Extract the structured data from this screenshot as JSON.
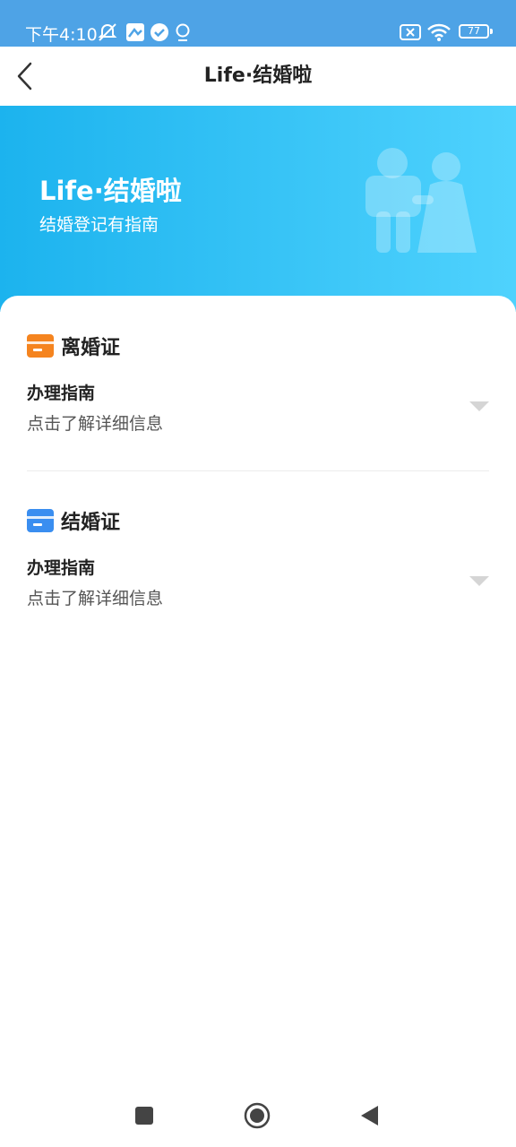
{
  "status_bar": {
    "time": "下午4:10",
    "battery": "77",
    "icons": [
      "mute-alarm-icon",
      "app-notification-icon",
      "check-badge-icon",
      "location-icon",
      "sim-error-icon",
      "wifi-icon",
      "battery-icon"
    ]
  },
  "nav": {
    "title": "Life·结婚啦",
    "back_icon": "chevron-left-icon"
  },
  "banner": {
    "title": "Life·结婚啦",
    "subtitle": "结婚登记有指南",
    "illustration": "couple-illustration"
  },
  "sections": [
    {
      "title": "离婚证",
      "icon": "divorce-certificate-icon",
      "icon_color": "#f5841f",
      "guide_title": "办理指南",
      "guide_desc": "点击了解详细信息"
    },
    {
      "title": "结婚证",
      "icon": "marriage-certificate-icon",
      "icon_color": "#3a8ef0",
      "guide_title": "办理指南",
      "guide_desc": "点击了解详细信息"
    }
  ],
  "system_nav": {
    "buttons": [
      "recent-apps-icon",
      "home-icon",
      "back-icon"
    ]
  },
  "colors": {
    "status_bar": "#4ea3e6",
    "banner_start": "#1cb3ee",
    "banner_end": "#4fd2fd"
  }
}
